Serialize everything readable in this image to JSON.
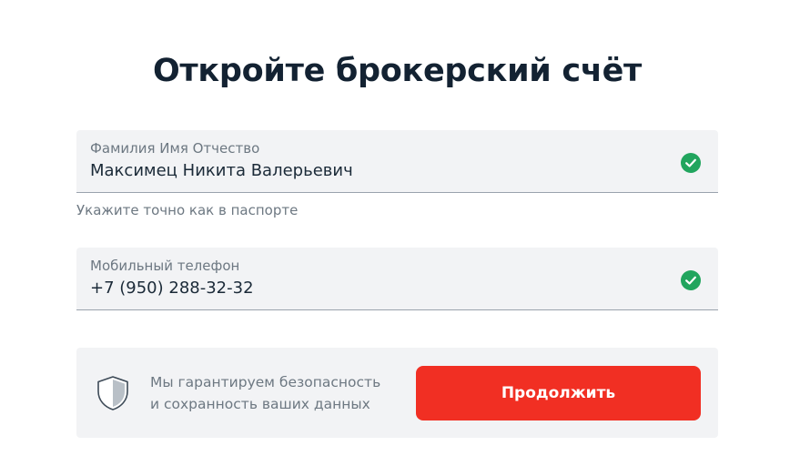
{
  "page": {
    "title": "Откройте брокерский счёт"
  },
  "form": {
    "full_name": {
      "label": "Фамилия Имя Отчество",
      "value": "Максимец Никита Валерьевич",
      "hint": "Укажите точно как в паспорте",
      "status_icon": "check-circle-icon",
      "status_color": "#21a55e"
    },
    "phone": {
      "label": "Мобильный телефон",
      "value": "+7 (950) 288-32-32",
      "status_icon": "check-circle-icon",
      "status_color": "#21a55e"
    }
  },
  "security": {
    "icon": "shield-icon",
    "line1": "Мы гарантируем безопасность",
    "line2": "и сохранность ваших данных"
  },
  "actions": {
    "continue_label": "Продолжить",
    "continue_color": "#f12f23"
  }
}
